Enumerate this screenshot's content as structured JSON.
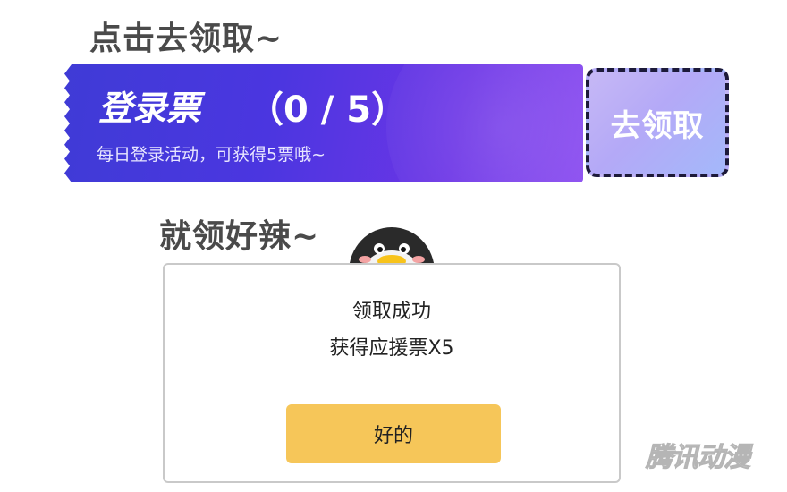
{
  "captions": {
    "top": "点击去领取~",
    "bottom": "就领好辣~"
  },
  "ticket": {
    "title": "登录票",
    "count": "（0 / 5）",
    "subtitle": "每日登录活动，可获得5票哦~",
    "claim_label": "去领取"
  },
  "dialog": {
    "line1": "领取成功",
    "line2": "获得应援票X5",
    "ok_label": "好的"
  },
  "watermark": "腾讯动漫",
  "colors": {
    "ticket_start": "#3f3bd6",
    "ticket_end": "#8a4cf0",
    "claim_bg": "#b4a9f7",
    "ok_button": "#f6c659"
  },
  "icons": {
    "mascot": "penguin-icon"
  }
}
